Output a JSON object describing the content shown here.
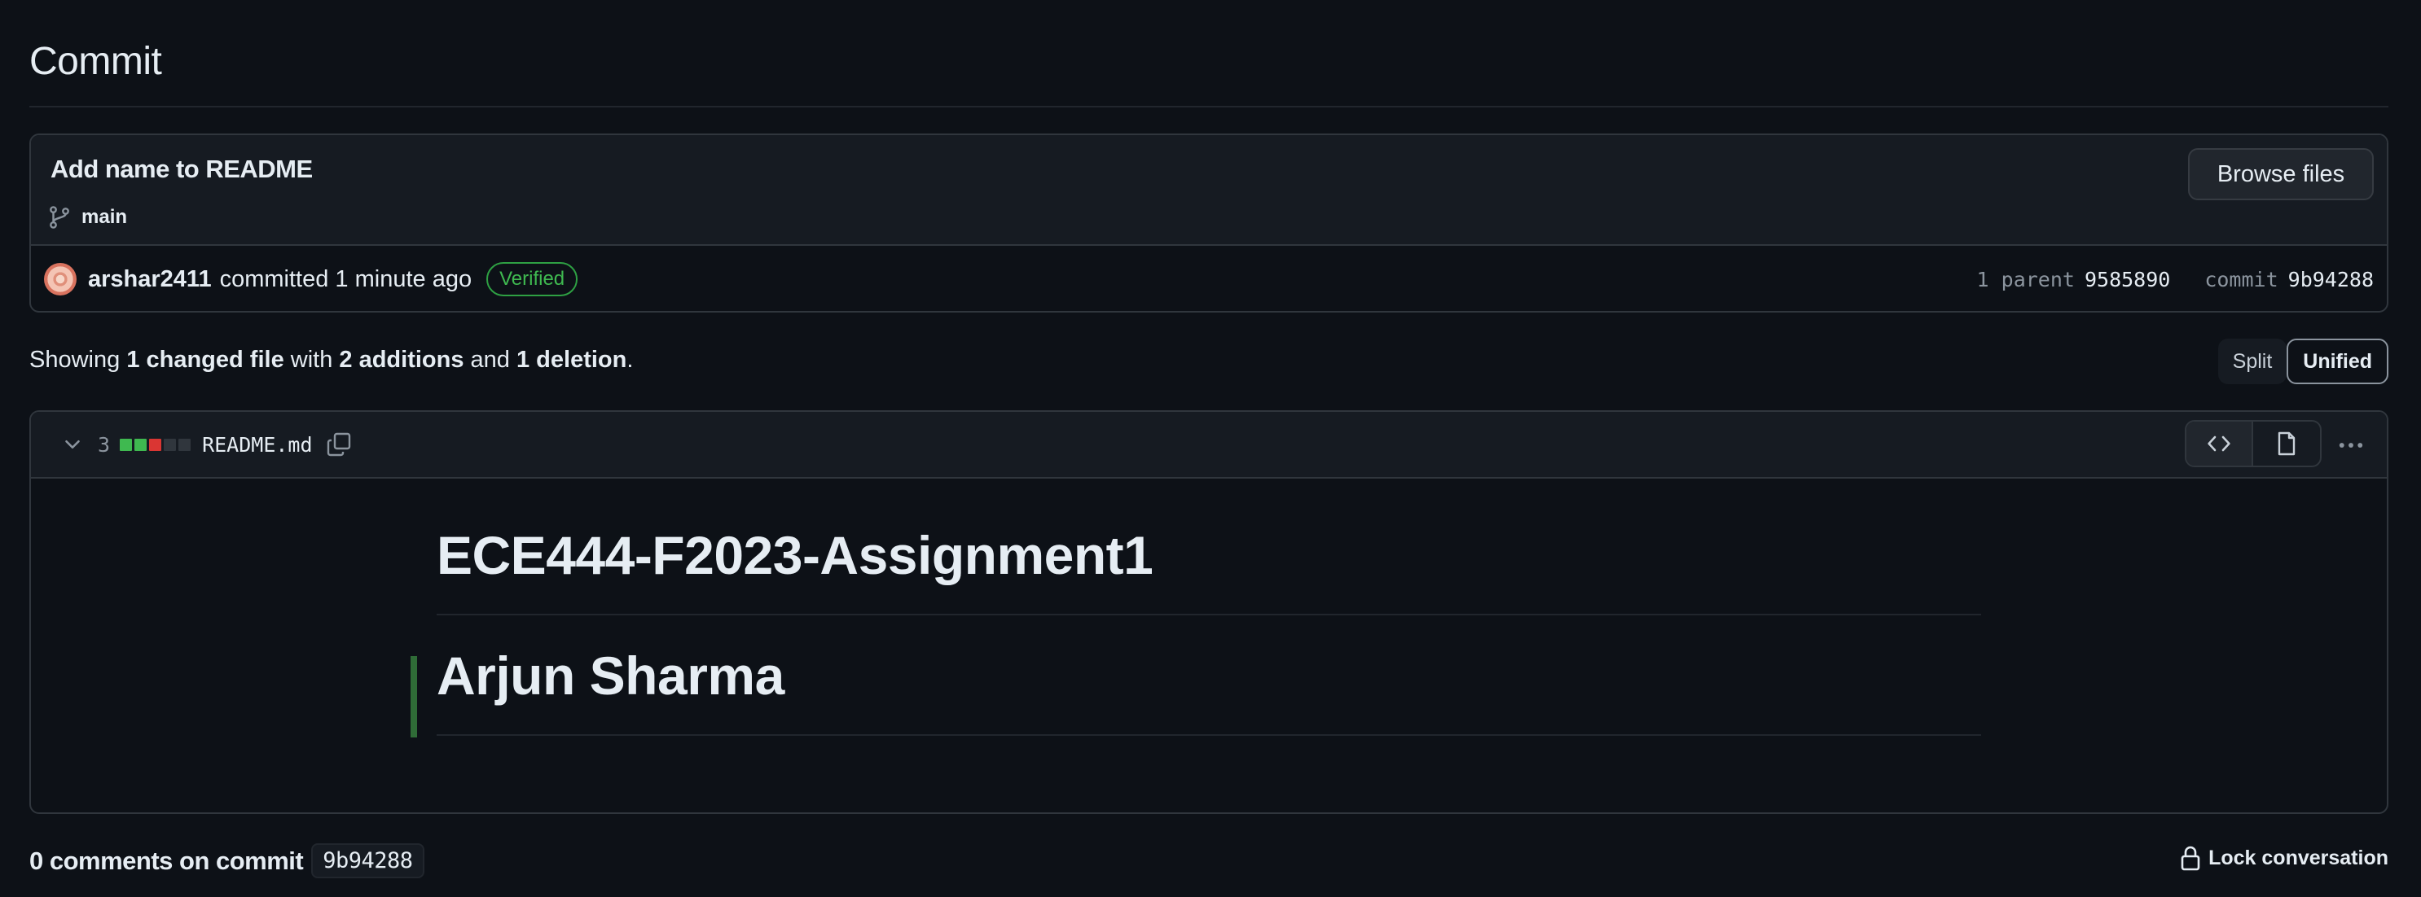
{
  "page": {
    "title": "Commit"
  },
  "commit": {
    "message": "Add name to README",
    "branch": "main",
    "browse_label": "Browse files",
    "author": "arshar2411",
    "action": "committed",
    "time": "1 minute ago",
    "badge": "Verified",
    "parent_label": "1 parent",
    "parent_sha": "9585890",
    "commit_label": "commit",
    "commit_sha": "9b94288"
  },
  "summary": {
    "showing": "Showing",
    "files": "1 changed file",
    "with": "with",
    "additions": "2 additions",
    "and": "and",
    "deletions": "1 deletion",
    "period": "."
  },
  "view_toggle": {
    "split": "Split",
    "unified": "Unified",
    "selected": "Unified"
  },
  "file": {
    "changes": "3",
    "name": "README.md",
    "diffstat": [
      "added",
      "added",
      "deleted",
      "neutral",
      "neutral"
    ],
    "content": {
      "heading1": "ECE444-F2023-Assignment1",
      "heading2": "Arjun Sharma"
    }
  },
  "comments": {
    "title": "0 comments on commit",
    "sha": "9b94288",
    "lock_label": "Lock conversation"
  },
  "colors": {
    "background": "#0d1117",
    "added": "#3fb950",
    "deleted": "#da3633",
    "neutral": "#30363d",
    "verified": "#3fb950"
  }
}
